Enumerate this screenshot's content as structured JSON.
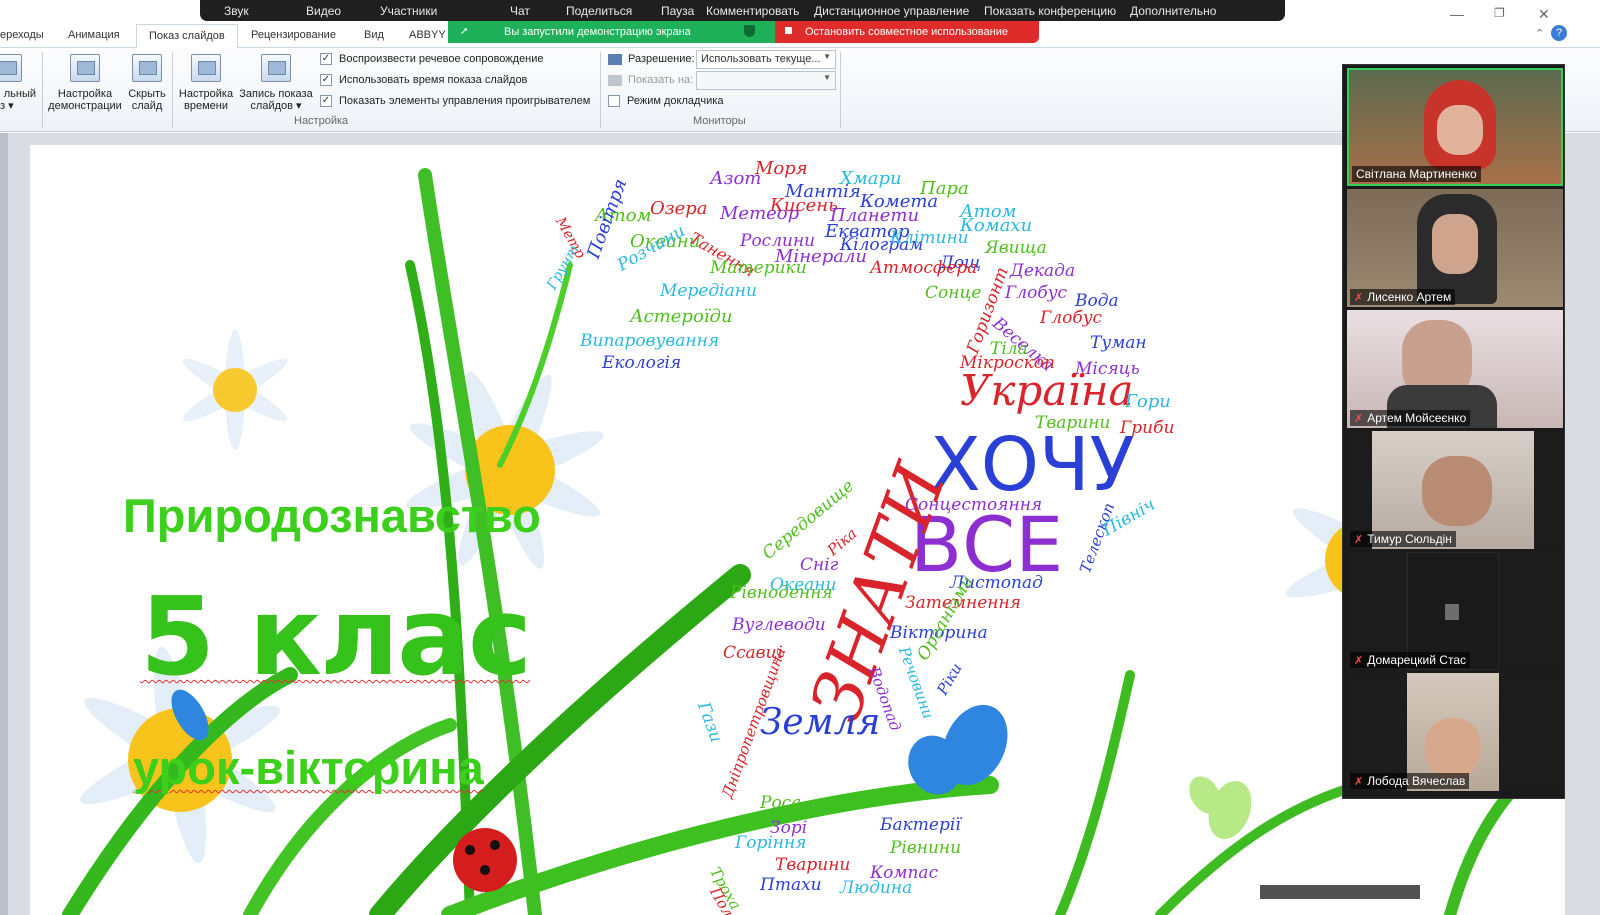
{
  "zoom_bar": {
    "items": [
      "Звук",
      "Видео",
      "Участники",
      "Чат",
      "Поделиться",
      "Пауза",
      "Комментировать",
      "Дистанционное управление",
      "Показать конференцию",
      "Дополнительно"
    ],
    "share_notice": "Вы запустили демонстрацию экрана",
    "stop_share": "Остановить совместное использование"
  },
  "ribbon": {
    "tabs": [
      "ереходы",
      "Анимация",
      "Показ слайдов",
      "Рецензирование",
      "Вид",
      "ABBYY"
    ],
    "active_tab": "Показ слайдов",
    "buttons": {
      "custom_partial_1": "льный",
      "custom_partial_2": "з ▾",
      "setup_1": "Настройка",
      "setup_2": "демонстрации",
      "hide_1": "Скрыть",
      "hide_2": "слайд",
      "timing_1": "Настройка",
      "timing_2": "времени",
      "record_1": "Запись показа",
      "record_2": "слайдов ▾"
    },
    "checkboxes": [
      {
        "label": "Воспроизвести речевое сопровождение",
        "checked": true
      },
      {
        "label": "Использовать время показа слайдов",
        "checked": true
      },
      {
        "label": "Показать элементы управления проигрывателем",
        "checked": true
      }
    ],
    "group_setup": "Настройка",
    "resolution_label": "Разрешение:",
    "resolution_value": "Использовать текуще...",
    "show_on_label": "Показать на:",
    "presenter_mode": "Режим докладчика",
    "group_monitors": "Мониторы"
  },
  "slide": {
    "subject": "Природознавство",
    "grade": "5 клас",
    "lesson": "урок-вікторина"
  },
  "word_cloud": {
    "big": [
      "ХОЧУ",
      "ВСЕ",
      "ЗНАТИ",
      "Україна",
      "Земля"
    ],
    "words": [
      "Моря",
      "Азот",
      "Мантія",
      "Хмари",
      "Пара",
      "Кисень",
      "Метеор",
      "Комета",
      "Атом",
      "Атом",
      "Озера",
      "Планети",
      "Екватор",
      "Комахи",
      "Океани",
      "Танення",
      "Рослини",
      "Кілограм",
      "Клітини",
      "Явища",
      "Метр",
      "Мінерали",
      "Дощ",
      "Розчини",
      "Материки",
      "Атмосфера",
      "Декада",
      "Повітря",
      "Мередіани",
      "Сонце",
      "Горизонт",
      "Глобус",
      "Вода",
      "Грунт",
      "Астероїди",
      "Глобус",
      "Веселка",
      "Туман",
      "Випаровування",
      "Тіла",
      "Мікроскоп",
      "Місяць",
      "Екологія",
      "Гори",
      "Тварини",
      "Гриби",
      "Сонцестояння",
      "Телескоп",
      "Північ",
      "Середовище",
      "Ріка",
      "Сніг",
      "Листопад",
      "Океани",
      "Рівнодення",
      "Затемнення",
      "Вуглеводи",
      "Вікторина",
      "Речовини",
      "Організми",
      "Ссавці",
      "Водопад",
      "Ріки",
      "Гази",
      "Роса",
      "Дніпропетровщина",
      "Зорі",
      "Бактерії",
      "Горіння",
      "Рівнини",
      "Тварини",
      "Компас",
      "Птахи",
      "Людина",
      "Троха",
      "Поля"
    ]
  },
  "participants": [
    {
      "name": "Світлана Мартиненко",
      "muted": false,
      "active": true
    },
    {
      "name": "Лисенко Артем",
      "muted": true,
      "active": false
    },
    {
      "name": "Артем Мойсеєнко",
      "muted": true,
      "active": false
    },
    {
      "name": "Тимур Сюльдін",
      "muted": true,
      "active": false
    },
    {
      "name": "Домарецкий Стас",
      "muted": true,
      "active": false
    },
    {
      "name": "Лобода Вячеслав",
      "muted": true,
      "active": false
    }
  ],
  "colors": {
    "zoom_green": "#1fb05a",
    "zoom_red": "#e02b2b",
    "title_green": "#3ccf1c",
    "cloud_palette": [
      "#d8242a",
      "#8d2fd0",
      "#2a3fd6",
      "#2ab9e0",
      "#4fbf1e"
    ]
  }
}
